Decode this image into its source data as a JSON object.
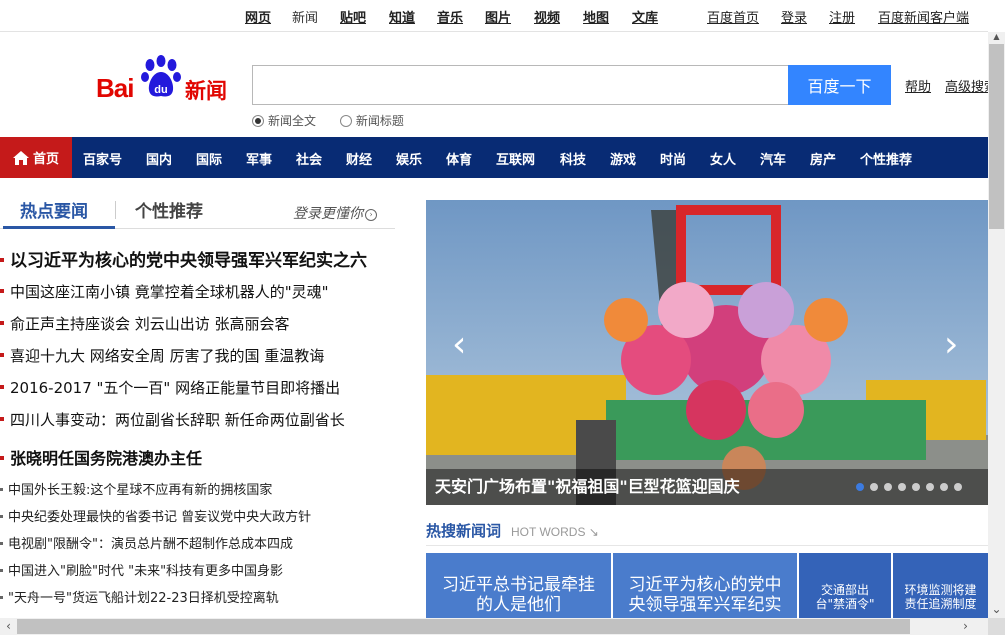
{
  "topnav": {
    "items": [
      "网页",
      "新闻",
      "贴吧",
      "知道",
      "音乐",
      "图片",
      "视频",
      "地图",
      "文库"
    ],
    "right": [
      "百度首页",
      "登录",
      "注册",
      "百度新闻客户端"
    ]
  },
  "logo": {
    "brand": "Bai",
    "paw_text": "du",
    "product": "新闻"
  },
  "search": {
    "value": "",
    "button": "百度一下",
    "help": "帮助",
    "advanced": "高级搜索",
    "options": [
      "新闻全文",
      "新闻标题"
    ],
    "selected": "新闻全文"
  },
  "channels": {
    "home": "首页",
    "items": [
      "百家号",
      "国内",
      "国际",
      "军事",
      "社会",
      "财经",
      "娱乐",
      "体育",
      "互联网",
      "科技",
      "游戏",
      "时尚",
      "女人",
      "汽车",
      "房产",
      "个性推荐"
    ]
  },
  "tabs": {
    "hot": "热点要闻",
    "personal": "个性推荐",
    "login_more": "登录更懂你"
  },
  "headlines": [
    "以习近平为核心的党中央领导强军兴军纪实之六",
    "中国这座江南小镇 竟掌控着全球机器人的\"灵魂\"",
    "俞正声主持座谈会  刘云山出访  张高丽会客",
    "喜迎十九大  网络安全周  厉害了我的国  重温教诲",
    "2016-2017 \"五个一百\" 网络正能量节目即将播出",
    "四川人事变动：两位副省长辞职 新任命两位副省长",
    "张晓明任国务院港澳办主任",
    "中国外长王毅:这个星球不应再有新的拥核国家",
    "中央纪委处理最快的省委书记 曾妄议党中央大政方针",
    "电视剧\"限酬令\"：演员总片酬不超制作总成本四成",
    "中国进入\"刷脸\"时代 \"未来\"科技有更多中国身影",
    "\"天舟一号\"货运飞船计划22-23日择机受控离轨"
  ],
  "carousel": {
    "caption": "天安门广场布置\"祝福祖国\"巨型花篮迎国庆",
    "prev": "‹",
    "next": "›",
    "slide_count": 8,
    "active_index": 0
  },
  "hotwords": {
    "title": "热搜新闻词",
    "subtitle": "HOT WORDS",
    "items": [
      "习近平总书记最牵挂的人是他们",
      "习近平为核心的党中央领导强军兴军纪实",
      "交通部出台\"禁酒令\"",
      "环境监测将建责任追溯制度"
    ]
  },
  "colors": {
    "accent_red": "#c51a1a",
    "nav_blue": "#082b74",
    "link_blue": "#2a57a5",
    "button_blue": "#3385ff"
  }
}
